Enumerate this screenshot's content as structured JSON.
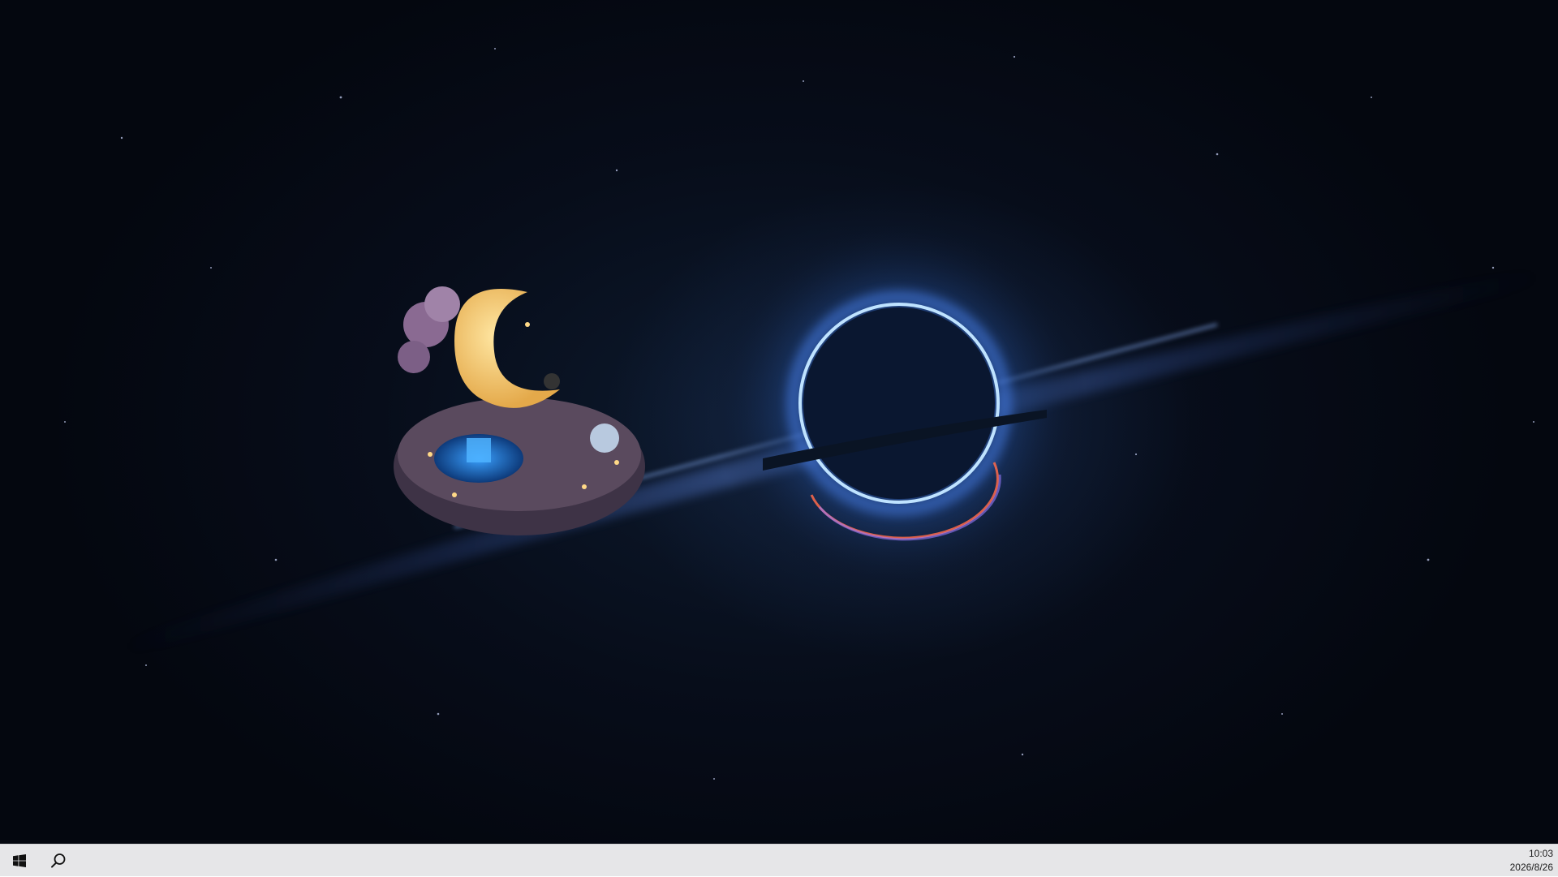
{
  "wallpaper": {
    "accent_ring": "#bfe3ff",
    "accent_glow": "#4f8bff",
    "accent_lower": "#ff6a4a",
    "sky": "#070d1a"
  },
  "taskbar": {
    "start_icon": "windows-logo-icon",
    "search_icon": "search-icon",
    "clock": {
      "time": "10:03",
      "date": "2026/8/26"
    }
  }
}
